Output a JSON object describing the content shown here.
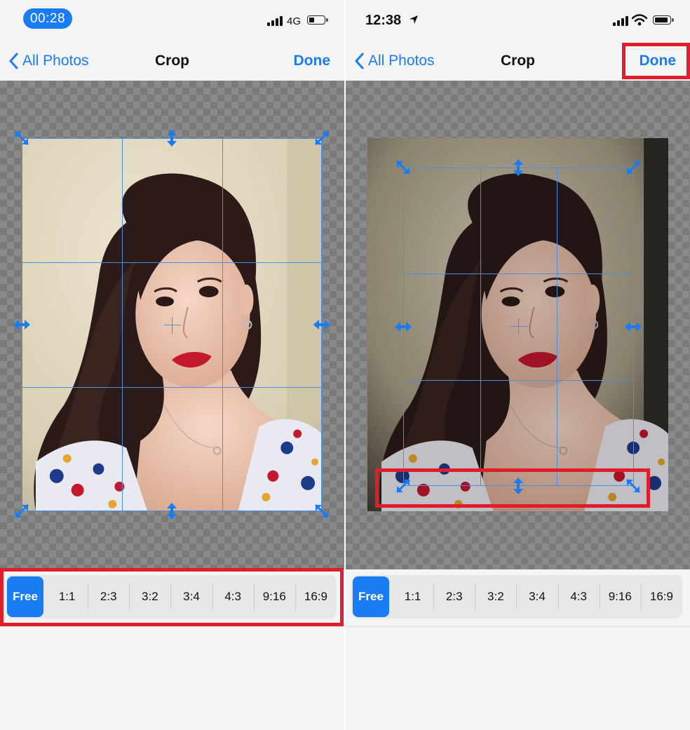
{
  "left": {
    "status": {
      "time": "00:28",
      "network": "4G"
    },
    "nav": {
      "back_label": "All Photos",
      "title": "Crop",
      "done_label": "Done"
    },
    "ratios": [
      "Free",
      "1:1",
      "2:3",
      "3:2",
      "3:4",
      "4:3",
      "9:16",
      "16:9"
    ],
    "selected_ratio": "Free"
  },
  "right": {
    "status": {
      "time": "12:38"
    },
    "nav": {
      "back_label": "All Photos",
      "title": "Crop",
      "done_label": "Done"
    },
    "ratios": [
      "Free",
      "1:1",
      "2:3",
      "3:2",
      "3:4",
      "4:3",
      "9:16",
      "16:9"
    ],
    "selected_ratio": "Free"
  },
  "colors": {
    "accent": "#1a7cf5",
    "highlight": "#e01e2b",
    "grid": "#4a8fe0"
  },
  "icons": [
    "chevron-left-icon",
    "diagonal-resize-icon",
    "vertical-resize-icon",
    "horizontal-resize-icon",
    "location-arrow-icon",
    "wifi-icon",
    "signal-icon",
    "battery-icon"
  ]
}
